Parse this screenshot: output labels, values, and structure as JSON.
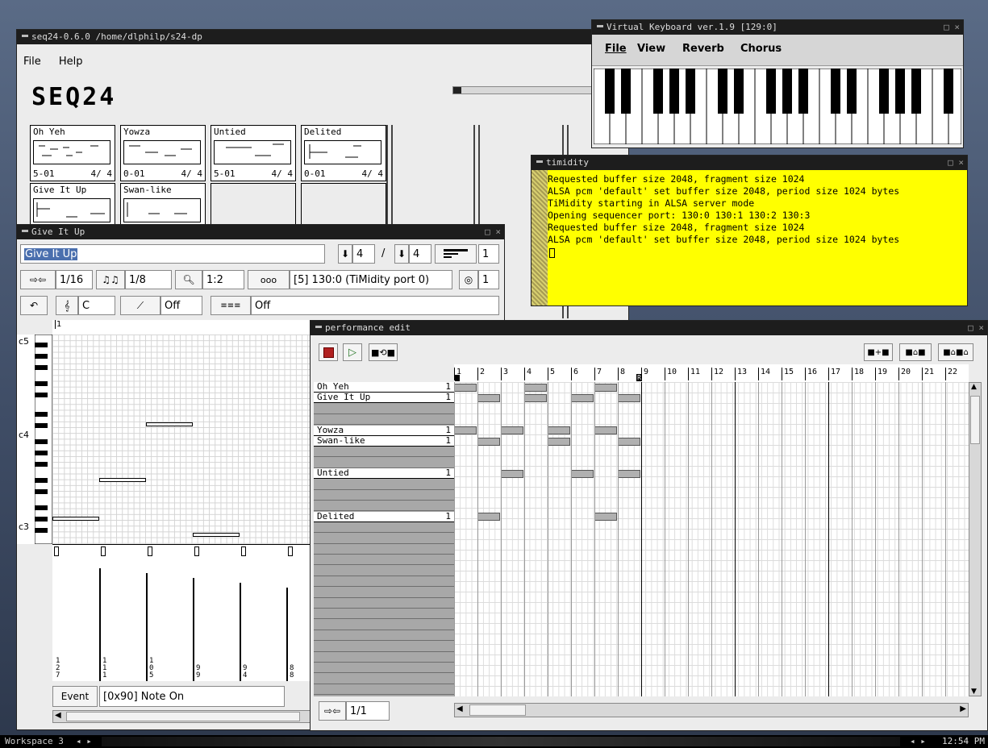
{
  "seq24": {
    "title": "seq24-0.6.0  /home/dlphilp/s24-dp",
    "menu": [
      "File",
      "Help"
    ],
    "logo": "SEQ24",
    "patterns": [
      {
        "name": "Oh Yeh",
        "ch": "5-01",
        "sig": "4/ 4"
      },
      {
        "name": "Yowza",
        "ch": "0-01",
        "sig": "4/ 4"
      },
      {
        "name": "Untied",
        "ch": "5-01",
        "sig": "4/ 4"
      },
      {
        "name": "Delited",
        "ch": "0-01",
        "sig": "4/ 4"
      },
      {
        "name": "Give It Up",
        "ch": "",
        "sig": ""
      },
      {
        "name": "Swan-like",
        "ch": "",
        "sig": ""
      }
    ]
  },
  "vkb": {
    "title": "Virtual Keyboard ver.1.9 [129:0]",
    "menu": [
      "File",
      "View",
      "Reverb",
      "Chorus"
    ]
  },
  "timidity": {
    "title": "timidity",
    "lines": [
      "Requested buffer size 2048, fragment size 1024",
      "ALSA pcm 'default' set buffer size 2048, period size 1024 bytes",
      "TiMidity starting in ALSA server mode",
      "Opening sequencer port: 130:0 130:1 130:2 130:3",
      "Requested buffer size 2048, fragment size 1024",
      "ALSA pcm 'default' set buffer size 2048, period size 1024 bytes"
    ],
    "bg": "#ffff00"
  },
  "editor": {
    "title": "Give It Up",
    "name_value": "Give It Up",
    "beats": "4",
    "slash": "/",
    "beat_width": "4",
    "measures": "1",
    "snap": "1/16",
    "note_len": "1/8",
    "zoom": "1:2",
    "midi_bus": "[5] 130:0 (TiMidity port 0)",
    "midi_ch": "1",
    "key": "C",
    "scale": "Off",
    "bg_seq": "Off",
    "ruler_mark": "1",
    "keys": [
      "c5",
      "c4",
      "c3"
    ],
    "event_label": "Event",
    "event_value": "[0x90] Note On",
    "velocity_labels": [
      "127",
      "111",
      "105",
      "99",
      "94",
      "88"
    ]
  },
  "perf": {
    "title": "performance edit",
    "measures": [
      "1",
      "2",
      "3",
      "4",
      "5",
      "6",
      "7",
      "8",
      "9",
      "10",
      "11",
      "12",
      "13",
      "14",
      "15",
      "16",
      "17",
      "18",
      "19",
      "20",
      "21",
      "22"
    ],
    "tracks": [
      {
        "name": "Oh Yeh",
        "count": "1",
        "active": true
      },
      {
        "name": "Give It Up",
        "count": "1",
        "active": true
      },
      {
        "name": "",
        "count": "",
        "active": false
      },
      {
        "name": "",
        "count": "",
        "active": false
      },
      {
        "name": "Yowza",
        "count": "1",
        "active": true
      },
      {
        "name": "Swan-like",
        "count": "1",
        "active": true
      },
      {
        "name": "",
        "count": "",
        "active": false
      },
      {
        "name": "",
        "count": "",
        "active": false
      },
      {
        "name": "Untied",
        "count": "1",
        "active": true
      },
      {
        "name": "",
        "count": "",
        "active": false
      },
      {
        "name": "",
        "count": "",
        "active": false
      },
      {
        "name": "",
        "count": "",
        "active": false
      },
      {
        "name": "Delited",
        "count": "1",
        "active": true
      }
    ],
    "blocks": [
      [
        1,
        4,
        7
      ],
      [
        2,
        4,
        6,
        8
      ],
      [],
      [],
      [
        1,
        3,
        5,
        7
      ],
      [
        2,
        5,
        8
      ],
      [],
      [],
      [
        3,
        6,
        8
      ],
      [],
      [],
      [],
      [
        2,
        7
      ]
    ],
    "snap": "1/1",
    "left_marker": "L",
    "right_marker": "R"
  },
  "taskbar": {
    "workspace": "Workspace 3",
    "clock": "12:54 PM"
  }
}
